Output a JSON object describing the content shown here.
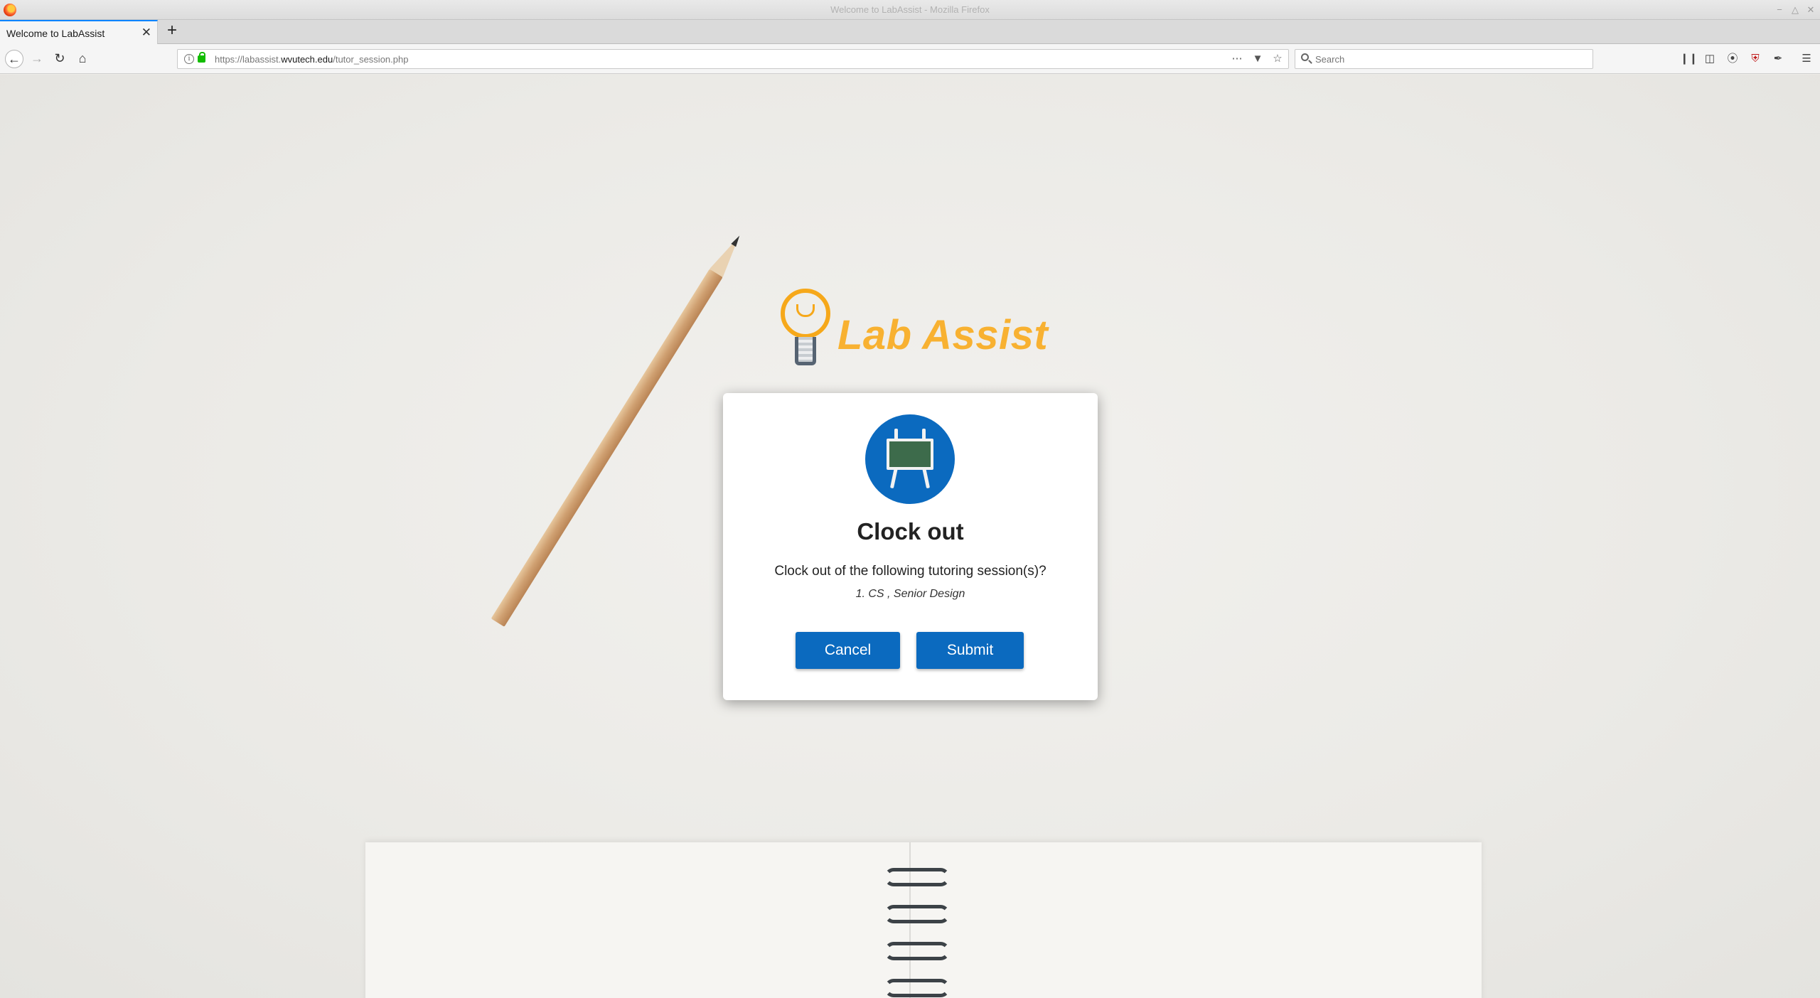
{
  "window": {
    "title": "Welcome to LabAssist - Mozilla Firefox"
  },
  "tabs": [
    {
      "label": "Welcome to LabAssist",
      "active": true
    }
  ],
  "navbar": {
    "url_prefix": "https://labassist.",
    "url_domain": "wvutech.edu",
    "url_path": "/tutor_session.php",
    "search_placeholder": "Search"
  },
  "page": {
    "logo_text": "Lab Assist",
    "logo_color": "#f8b131"
  },
  "modal": {
    "title": "Clock out",
    "question": "Clock out of the following tutoring session(s)?",
    "sessions": [
      "1. CS , Senior Design"
    ],
    "cancel_label": "Cancel",
    "submit_label": "Submit",
    "accent_color": "#0b6abf",
    "icon": "easel-chalkboard-icon"
  }
}
